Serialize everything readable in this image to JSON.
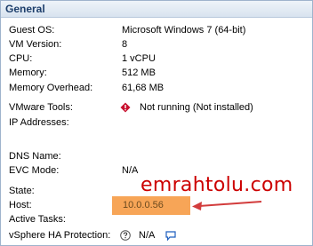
{
  "panel": {
    "title": "General"
  },
  "rows": {
    "guest_os": {
      "label": "Guest OS:",
      "value": "Microsoft Windows 7 (64-bit)"
    },
    "vm_version": {
      "label": "VM Version:",
      "value": "8"
    },
    "cpu": {
      "label": "CPU:",
      "value": "1 vCPU"
    },
    "memory": {
      "label": "Memory:",
      "value": "512 MB"
    },
    "memory_overhead": {
      "label": "Memory Overhead:",
      "value": "61,68 MB"
    },
    "vmware_tools": {
      "label": "VMware Tools:",
      "value": "Not running (Not installed)",
      "icon": "warning-icon"
    },
    "ip_addresses": {
      "label": "IP Addresses:",
      "value": ""
    },
    "dns_name": {
      "label": "DNS Name:",
      "value": ""
    },
    "evc_mode": {
      "label": "EVC Mode:",
      "value": "N/A"
    },
    "state": {
      "label": "State:",
      "value": ""
    },
    "host": {
      "label": "Host:",
      "value": "10.0.0.56"
    },
    "active_tasks": {
      "label": "Active Tasks:",
      "value": ""
    },
    "vsphere_ha": {
      "label": "vSphere HA Protection:",
      "value": "N/A",
      "icons": [
        "help-icon",
        "comment-icon"
      ]
    }
  },
  "watermark": "emrahtolu.com",
  "colors": {
    "header_title": "#1d3e6b",
    "host_highlight": "#f7a557",
    "watermark": "#cc0000",
    "arrow": "#d23c3c"
  }
}
